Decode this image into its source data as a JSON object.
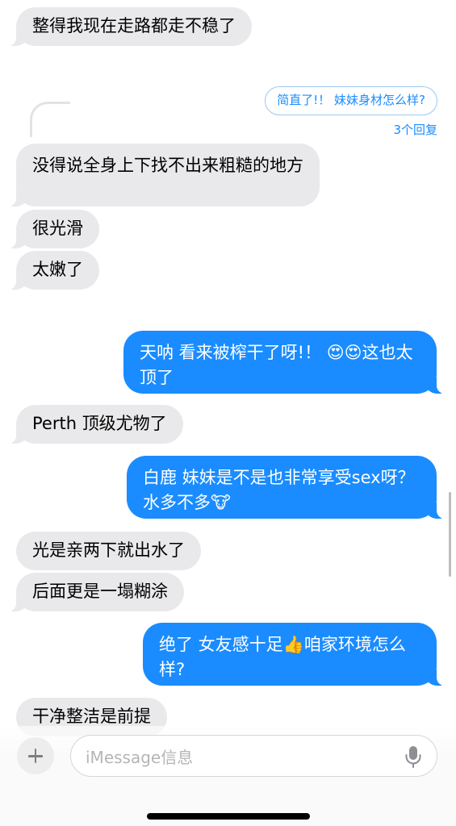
{
  "messages": [
    {
      "id": "m1",
      "side": "in",
      "text": "整得我现在走路都走不稳了"
    },
    {
      "id": "m2",
      "side": "in",
      "text": "没得说全身上下找不出来粗糙的地方"
    },
    {
      "id": "m3",
      "side": "in",
      "text": "很光滑"
    },
    {
      "id": "m4",
      "side": "in",
      "text": "太嫩了"
    },
    {
      "id": "m5",
      "side": "out",
      "text": "天呐 看来被榨干了呀!！ 😍😍这也太顶了"
    },
    {
      "id": "m6",
      "side": "in",
      "text": "Perth 顶级尤物了"
    },
    {
      "id": "m7",
      "side": "out",
      "text": "白鹿  妹妹是不是也非常享受sex呀？水多不多🐮"
    },
    {
      "id": "m8",
      "side": "in",
      "text": "光是亲两下就出水了"
    },
    {
      "id": "m9",
      "side": "in",
      "text": "后面更是一塌糊涂"
    },
    {
      "id": "m10",
      "side": "out",
      "text": "绝了 女友感十足👍咱家环境怎么样?"
    },
    {
      "id": "m11",
      "side": "in",
      "text": "干净整洁是前提"
    }
  ],
  "quoted_reply": {
    "text": "简直了!！ 妹妹身材怎么样?",
    "reply_count": "3个回复"
  },
  "composer": {
    "placeholder": "iMessage信息"
  },
  "colors": {
    "outgoing": "#1a8cff",
    "incoming": "#e9e9eb",
    "accent": "#1a8cff"
  },
  "icons": [
    "plus-icon",
    "microphone-icon"
  ]
}
